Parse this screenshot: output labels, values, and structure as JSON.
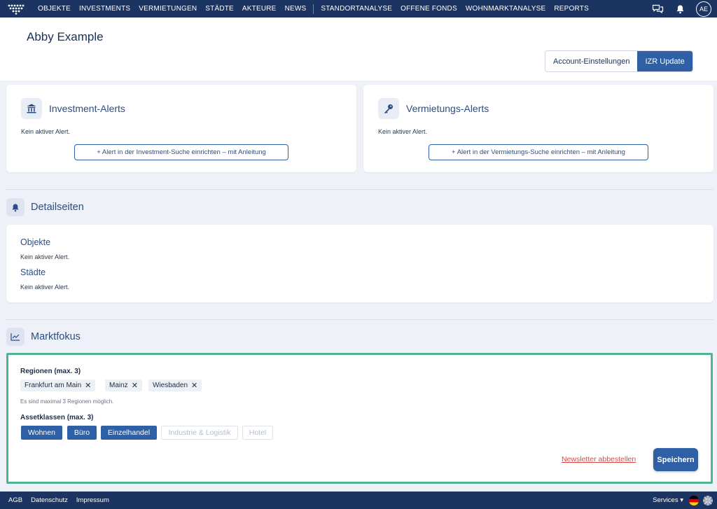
{
  "nav": {
    "items": [
      "OBJEKTE",
      "INVESTMENTS",
      "VERMIETUNGEN",
      "STÄDTE",
      "AKTEURE",
      "NEWS"
    ],
    "items2": [
      "STANDORTANALYSE",
      "OFFENE FONDS",
      "WOHNMARKTANALYSE",
      "REPORTS"
    ],
    "avatar": "AE"
  },
  "header": {
    "title": "Abby Example",
    "account_settings": "Account-Einstellungen",
    "izr_update": "IZR Update"
  },
  "investment_alerts": {
    "title": "Investment-Alerts",
    "status": "Kein aktiver Alert.",
    "button": "+ Alert in der Investment-Suche einrichten – mit Anleitung"
  },
  "rental_alerts": {
    "title": "Vermietungs-Alerts",
    "status": "Kein aktiver Alert.",
    "button": "+ Alert in der Vermietungs-Suche einrichten – mit Anleitung"
  },
  "detail_pages": {
    "title": "Detailseiten",
    "objects_title": "Objekte",
    "objects_status": "Kein aktiver Alert.",
    "cities_title": "Städte",
    "cities_status": "Kein aktiver Alert."
  },
  "market_focus": {
    "title": "Marktfokus",
    "regions_label": "Regionen (max. 3)",
    "regions": [
      "Frankfurt am Main",
      "Mainz",
      "Wiesbaden"
    ],
    "regions_hint": "Es sind maximal 3 Regionen möglich.",
    "assets_label": "Assetklassen (max. 3)",
    "assets": [
      {
        "label": "Wohnen",
        "selected": true
      },
      {
        "label": "Büro",
        "selected": true
      },
      {
        "label": "Einzelhandel",
        "selected": true
      },
      {
        "label": "Industrie & Logistik",
        "selected": false
      },
      {
        "label": "Hotel",
        "selected": false
      }
    ],
    "unsubscribe": "Newsletter abbestellen",
    "save": "Speichern"
  },
  "footer": {
    "links": [
      "AGB",
      "Datenschutz",
      "Impressum"
    ],
    "services": "Services ▾"
  },
  "colors": {
    "nav_bg": "#1c3461",
    "accent": "#2f5fa5",
    "focus_border": "#52b394",
    "unsubscribe": "#d24b4b"
  }
}
